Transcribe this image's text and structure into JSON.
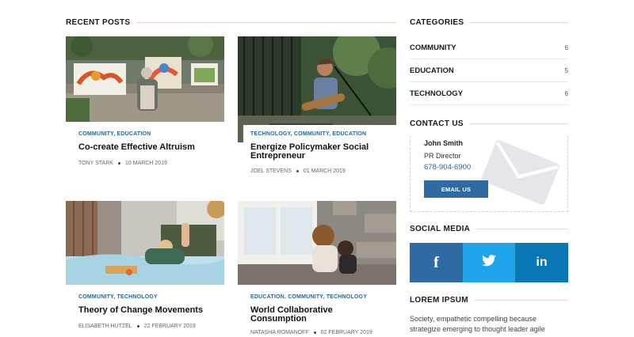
{
  "recent_posts": {
    "heading": "RECENT POSTS",
    "posts": [
      {
        "categories": [
          "COMMUNITY",
          "EDUCATION"
        ],
        "title": "Co-create Effective Altruism",
        "author": "TONY STARK",
        "date": "10 MARCH 2019"
      },
      {
        "categories": [
          "TECHNOLOGY",
          "COMMUNITY",
          "EDUCATION"
        ],
        "title": "Energize Policymaker Social Entrepreneur",
        "author": "JOEL STEVENS",
        "date": "01 MARCH 2019"
      },
      {
        "categories": [
          "COMMUNITY",
          "TECHNOLOGY"
        ],
        "title": "Theory of Change Movements",
        "author": "ELISABETH HUTZEL",
        "date": "22 FEBRUARY 2019"
      },
      {
        "categories": [
          "EDUCATION",
          "COMMUNITY",
          "TECHNOLOGY"
        ],
        "title": "World Collaborative Consumption",
        "author": "NATASHA ROMANOFF",
        "date": "02 FEBRUARY 2019"
      }
    ]
  },
  "categories": {
    "heading": "CATEGORIES",
    "items": [
      {
        "name": "COMMUNITY",
        "count": "6"
      },
      {
        "name": "EDUCATION",
        "count": "5"
      },
      {
        "name": "TECHNOLOGY",
        "count": "6"
      }
    ]
  },
  "contact": {
    "heading": "CONTACT US",
    "name": "John Smith",
    "role": "PR Director",
    "phone": "678-904-6900",
    "button_label": "EMAIL US",
    "icon": "envelope-icon"
  },
  "social": {
    "heading": "SOCIAL MEDIA",
    "networks": [
      {
        "icon": "facebook-icon",
        "glyph": "f",
        "color": "#2f6aa3"
      },
      {
        "icon": "twitter-icon",
        "glyph": "",
        "color": "#1fa3ea"
      },
      {
        "icon": "linkedin-icon",
        "glyph": "in",
        "color": "#0a77b5"
      }
    ]
  },
  "lorem": {
    "heading": "LOREM IPSUM",
    "text": "Society, empathetic compelling because strategize emerging to thought leader agile"
  },
  "colors": {
    "accent": "#2a6496",
    "button": "#2f6aa3",
    "rule": "#d9d9d9"
  }
}
